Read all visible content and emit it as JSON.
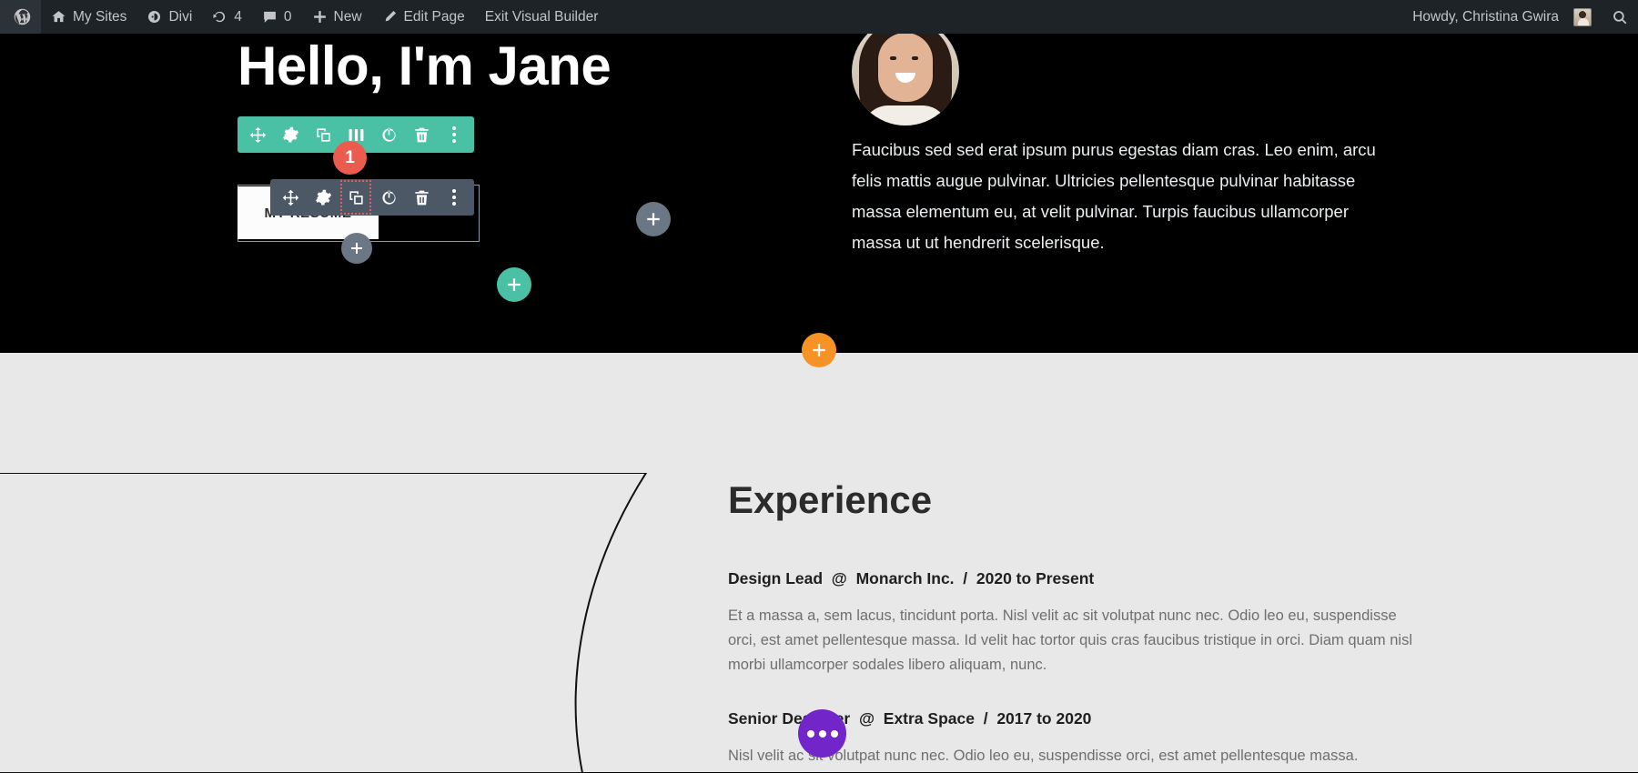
{
  "adminbar": {
    "logo_icon": "wordpress-logo-icon",
    "items": [
      {
        "label": "My Sites",
        "icon": "sites-icon"
      },
      {
        "label": "Divi",
        "icon": "divi-icon"
      },
      {
        "label": "4",
        "icon": "updates-icon"
      },
      {
        "label": "0",
        "icon": "comments-icon"
      },
      {
        "label": "New",
        "icon": "plus-icon"
      },
      {
        "label": "Edit Page",
        "icon": "pencil-icon"
      },
      {
        "label": "Exit Visual Builder",
        "icon": "none"
      }
    ],
    "howdy": "Howdy, Christina Gwira",
    "avatar_icon": "user-avatar",
    "search_icon": "search-icon"
  },
  "hero": {
    "title": "Hello, I'm Jane",
    "photo_icon": "profile-photo",
    "paragraph": "Faucibus sed sed erat ipsum purus egestas diam cras. Leo enim, arcu felis mattis augue pulvinar. Ultricies pellentesque pulvinar habitasse massa elementum eu, at velit pulvinar. Turpis faucibus ullamcorper massa ut ut hendrerit scelerisque.",
    "button_label": "MY RESUME"
  },
  "experience": {
    "title": "Experience",
    "jobs": [
      {
        "role": "Design Lead",
        "at": "@",
        "company": "Monarch Inc.",
        "slash": "/",
        "dates": "2020 to Present",
        "body": "Et a massa a, sem lacus, tincidunt porta. Nisl velit ac sit volutpat nunc nec. Odio leo eu, suspendisse orci, est amet pellentesque massa. Id velit hac tortor quis cras faucibus tristique in orci. Diam quam nisl morbi ullamcorper sodales libero aliquam, nunc."
      },
      {
        "role": "Senior Designer",
        "at": "@",
        "company": "Extra Space",
        "slash": "/",
        "dates": "2017 to 2020",
        "body": "Nisl velit ac sit volutpat nunc nec. Odio leo eu, suspendisse orci, est amet pellentesque massa."
      }
    ]
  },
  "builder": {
    "row_toolbar": {
      "color": "#4ac1a4",
      "buttons": [
        {
          "icon": "move-icon",
          "name": "drag-row"
        },
        {
          "icon": "gear-icon",
          "name": "row-settings"
        },
        {
          "icon": "duplicate-icon",
          "name": "duplicate-row"
        },
        {
          "icon": "columns-icon",
          "name": "change-column-structure"
        },
        {
          "icon": "power-icon",
          "name": "disable-row"
        },
        {
          "icon": "trash-icon",
          "name": "delete-row"
        },
        {
          "icon": "ellipsis-vertical-icon",
          "name": "row-more-options"
        }
      ]
    },
    "module_toolbar": {
      "color": "#4c5866",
      "buttons": [
        {
          "icon": "move-icon",
          "name": "drag-module"
        },
        {
          "icon": "gear-icon",
          "name": "module-settings"
        },
        {
          "icon": "duplicate-icon",
          "name": "duplicate-module",
          "selected": true
        },
        {
          "icon": "power-icon",
          "name": "disable-module"
        },
        {
          "icon": "trash-icon",
          "name": "delete-module"
        },
        {
          "icon": "ellipsis-vertical-icon",
          "name": "module-more-options"
        }
      ]
    },
    "badge": {
      "label": "1",
      "color": "#ea5d4e"
    },
    "add_module": {
      "icon": "plus-icon",
      "color": "#6c7785"
    },
    "add_module_2": {
      "icon": "plus-icon",
      "color": "#6c7785"
    },
    "add_row": {
      "icon": "plus-icon",
      "color": "#4ac1a4"
    },
    "add_section": {
      "icon": "plus-icon",
      "color": "#f79326"
    },
    "page_settings": {
      "icon": "ellipsis-horizontal-icon",
      "color": "#7226c9"
    }
  }
}
